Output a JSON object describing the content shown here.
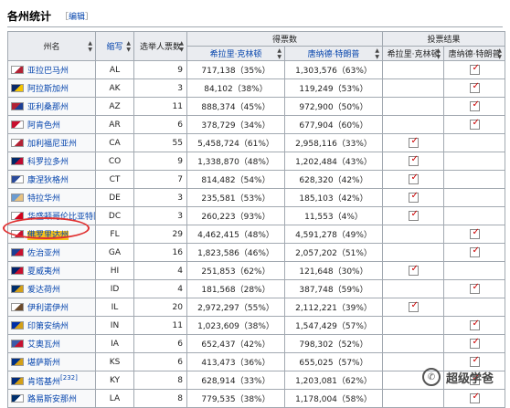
{
  "header": {
    "title": "各州统计",
    "edit_open": "［",
    "edit_label": "编辑",
    "edit_close": "］"
  },
  "table": {
    "col_state": "州名",
    "col_abbr": "缩写",
    "col_ev": "选举人票数",
    "col_votes": "得票数",
    "col_result": "投票结果",
    "col_clinton": "希拉里·克林顿",
    "col_trump": "唐纳德·特朗普",
    "rows": [
      {
        "state": "亚拉巴马州",
        "abbr": "AL",
        "ev": "9",
        "clinton": "717,138（35%）",
        "trump": "1,303,576（63%）",
        "winner": "trump",
        "flag": [
          "#ffffff",
          "#b22234"
        ]
      },
      {
        "state": "阿拉斯加州",
        "abbr": "AK",
        "ev": "3",
        "clinton": "84,102（38%）",
        "trump": "119,249（53%）",
        "winner": "trump",
        "flag": [
          "#0b2a6b",
          "#f5c400"
        ]
      },
      {
        "state": "亚利桑那州",
        "abbr": "AZ",
        "ev": "11",
        "clinton": "888,374（45%）",
        "trump": "972,900（50%）",
        "winner": "trump",
        "flag": [
          "#b22234",
          "#1c3f94"
        ]
      },
      {
        "state": "阿肯色州",
        "abbr": "AR",
        "ev": "6",
        "clinton": "378,729（34%）",
        "trump": "677,904（60%）",
        "winner": "trump",
        "flag": [
          "#c8102e",
          "#ffffff"
        ]
      },
      {
        "state": "加利福尼亚州",
        "abbr": "CA",
        "ev": "55",
        "clinton": "5,458,724（61%）",
        "trump": "2,958,116（33%）",
        "winner": "clinton",
        "flag": [
          "#ffffff",
          "#b22234"
        ]
      },
      {
        "state": "科罗拉多州",
        "abbr": "CO",
        "ev": "9",
        "clinton": "1,338,870（48%）",
        "trump": "1,202,484（43%）",
        "winner": "clinton",
        "flag": [
          "#002868",
          "#bf0a30"
        ]
      },
      {
        "state": "康涅狄格州",
        "abbr": "CT",
        "ev": "7",
        "clinton": "814,482（54%）",
        "trump": "628,320（42%）",
        "winner": "clinton",
        "flag": [
          "#2b4b9b",
          "#ffffff"
        ]
      },
      {
        "state": "特拉华州",
        "abbr": "DE",
        "ev": "3",
        "clinton": "235,581（53%）",
        "trump": "185,103（42%）",
        "winner": "clinton",
        "flag": [
          "#6b9bd1",
          "#e8c280"
        ]
      },
      {
        "state": "华盛顿哥伦比亚特区",
        "abbr": "DC",
        "ev": "3",
        "clinton": "260,223（93%）",
        "trump": "11,553（4%）",
        "winner": "clinton",
        "flag": [
          "#ffffff",
          "#d0021b"
        ]
      },
      {
        "state": "佛罗里达州",
        "abbr": "FL",
        "ev": "29",
        "clinton": "4,462,415（48%）",
        "trump": "4,591,278（49%）",
        "winner": "trump",
        "flag": [
          "#ffffff",
          "#c8102e"
        ]
      },
      {
        "state": "佐治亚州",
        "abbr": "GA",
        "ev": "16",
        "clinton": "1,823,586（46%）",
        "trump": "2,057,202（51%）",
        "winner": "trump",
        "flag": [
          "#1c3f94",
          "#c8102e"
        ]
      },
      {
        "state": "夏威夷州",
        "abbr": "HI",
        "ev": "4",
        "clinton": "251,853（62%）",
        "trump": "121,648（30%）",
        "winner": "clinton",
        "flag": [
          "#012169",
          "#c8102e"
        ]
      },
      {
        "state": "爱达荷州",
        "abbr": "ID",
        "ev": "4",
        "clinton": "181,568（28%）",
        "trump": "387,748（59%）",
        "winner": "trump",
        "flag": [
          "#002e6d",
          "#d4a017"
        ]
      },
      {
        "state": "伊利诺伊州",
        "abbr": "IL",
        "ev": "20",
        "clinton": "2,972,297（55%）",
        "trump": "2,112,221（39%）",
        "winner": "clinton",
        "flag": [
          "#ffffff",
          "#6b4a2b"
        ]
      },
      {
        "state": "印第安纳州",
        "abbr": "IN",
        "ev": "11",
        "clinton": "1,023,609（38%）",
        "trump": "1,547,429（57%）",
        "winner": "trump",
        "flag": [
          "#002fa7",
          "#d4a017"
        ]
      },
      {
        "state": "艾奥瓦州",
        "abbr": "IA",
        "ev": "6",
        "clinton": "652,437（42%）",
        "trump": "798,302（52%）",
        "winner": "trump",
        "flag": [
          "#3b5ba9",
          "#c8102e"
        ]
      },
      {
        "state": "堪萨斯州",
        "abbr": "KS",
        "ev": "6",
        "clinton": "413,473（36%）",
        "trump": "655,025（57%）",
        "winner": "trump",
        "flag": [
          "#003087",
          "#d4a017"
        ]
      },
      {
        "state": "肯塔基州",
        "abbr": "KY",
        "ev": "8",
        "clinton": "628,914（33%）",
        "trump": "1,203,081（62%）",
        "winner": "trump",
        "ref": "[232]",
        "flag": [
          "#002a7a",
          "#d4a017"
        ]
      },
      {
        "state": "路易斯安那州",
        "abbr": "LA",
        "ev": "8",
        "clinton": "779,535（38%）",
        "trump": "1,178,004（58%）",
        "winner": "trump",
        "flag": [
          "#002f6c",
          "#ffffff"
        ]
      }
    ]
  },
  "watermark": {
    "text": "超级学爸",
    "icon": "wechat-icon"
  },
  "colors": {
    "link": "#0645ad",
    "header_bg": "#eaecf0",
    "border": "#a2a9b1",
    "highlight": "#f6c21c",
    "circle": "#e03030",
    "tick": "#cc0000"
  }
}
